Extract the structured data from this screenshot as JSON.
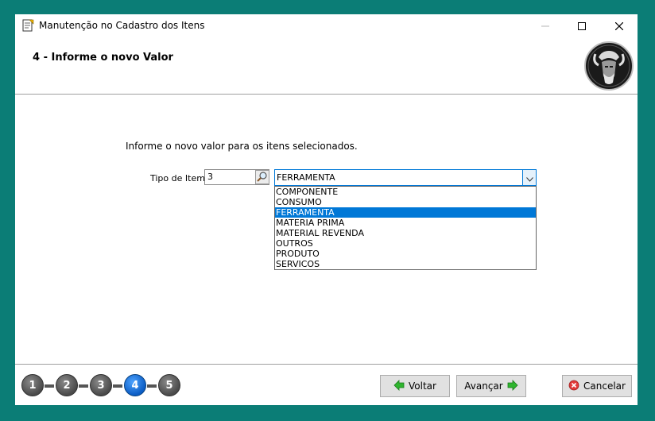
{
  "window": {
    "title": "Manutenção no Cadastro dos Itens"
  },
  "step": {
    "title": "4 - Informe o novo Valor"
  },
  "form": {
    "instruction": "Informe o novo valor para os itens selecionados.",
    "tipo_label": "Tipo de Item:",
    "tipo_code": "3",
    "combo_value": "FERRAMENTA",
    "options": [
      "COMPONENTE",
      "CONSUMO",
      "FERRAMENTA",
      "MATERIA PRIMA",
      "MATERIAL REVENDA",
      "OUTROS",
      "PRODUTO",
      "SERVICOS"
    ],
    "selected_option": "FERRAMENTA"
  },
  "wizard": {
    "steps": [
      "1",
      "2",
      "3",
      "4",
      "5"
    ],
    "current_step": "4"
  },
  "buttons": {
    "back": "Voltar",
    "next": "Avançar",
    "cancel": "Cancelar"
  },
  "colors": {
    "desktop": "#0b7d76",
    "selection": "#0078d7",
    "active_step": "#0b5cc4",
    "inactive_step": "#4a4a4a",
    "back_arrow": "#2fb52f",
    "next_arrow": "#2fb52f",
    "cancel_icon": "#e23b3b"
  },
  "icons": {
    "app": "app-icon",
    "lookup": "magnifier-icon",
    "combo_arrow": "chevron-down-icon",
    "back": "arrow-left-icon",
    "next": "arrow-right-icon",
    "cancel": "cancel-icon",
    "logo": "viking-logo"
  }
}
